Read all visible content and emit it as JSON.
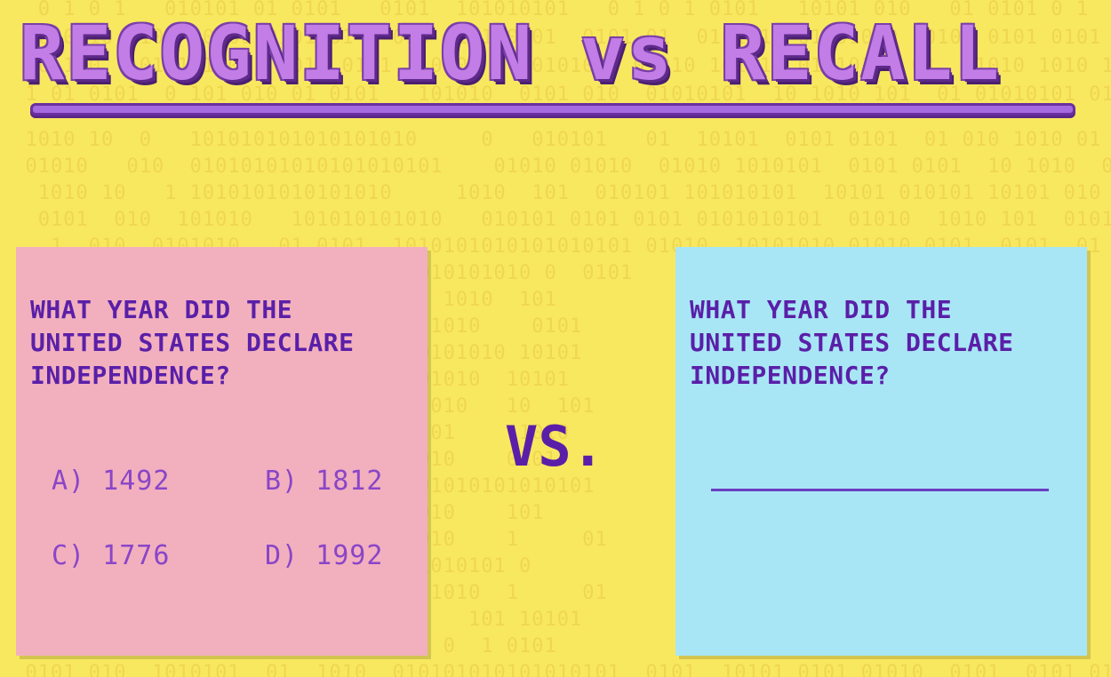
{
  "title": "RECOGNITION vs RECALL",
  "vs_label": "VS.",
  "left_card": {
    "question": "WHAT YEAR DID THE\nUNITED STATES DECLARE\nINDEPENDENCE?",
    "options": [
      "A) 1492",
      "B) 1812",
      "C) 1776",
      "D) 1992"
    ]
  },
  "right_card": {
    "question": "WHAT YEAR DID THE\nUNITED STATES DECLARE\nINDEPENDENCE?"
  },
  "colors": {
    "background": "#f8e860",
    "left_card": "#f2b0be",
    "right_card": "#a8e6f6",
    "text": "#5a1fa8",
    "title_fill": "#c27de6"
  }
}
